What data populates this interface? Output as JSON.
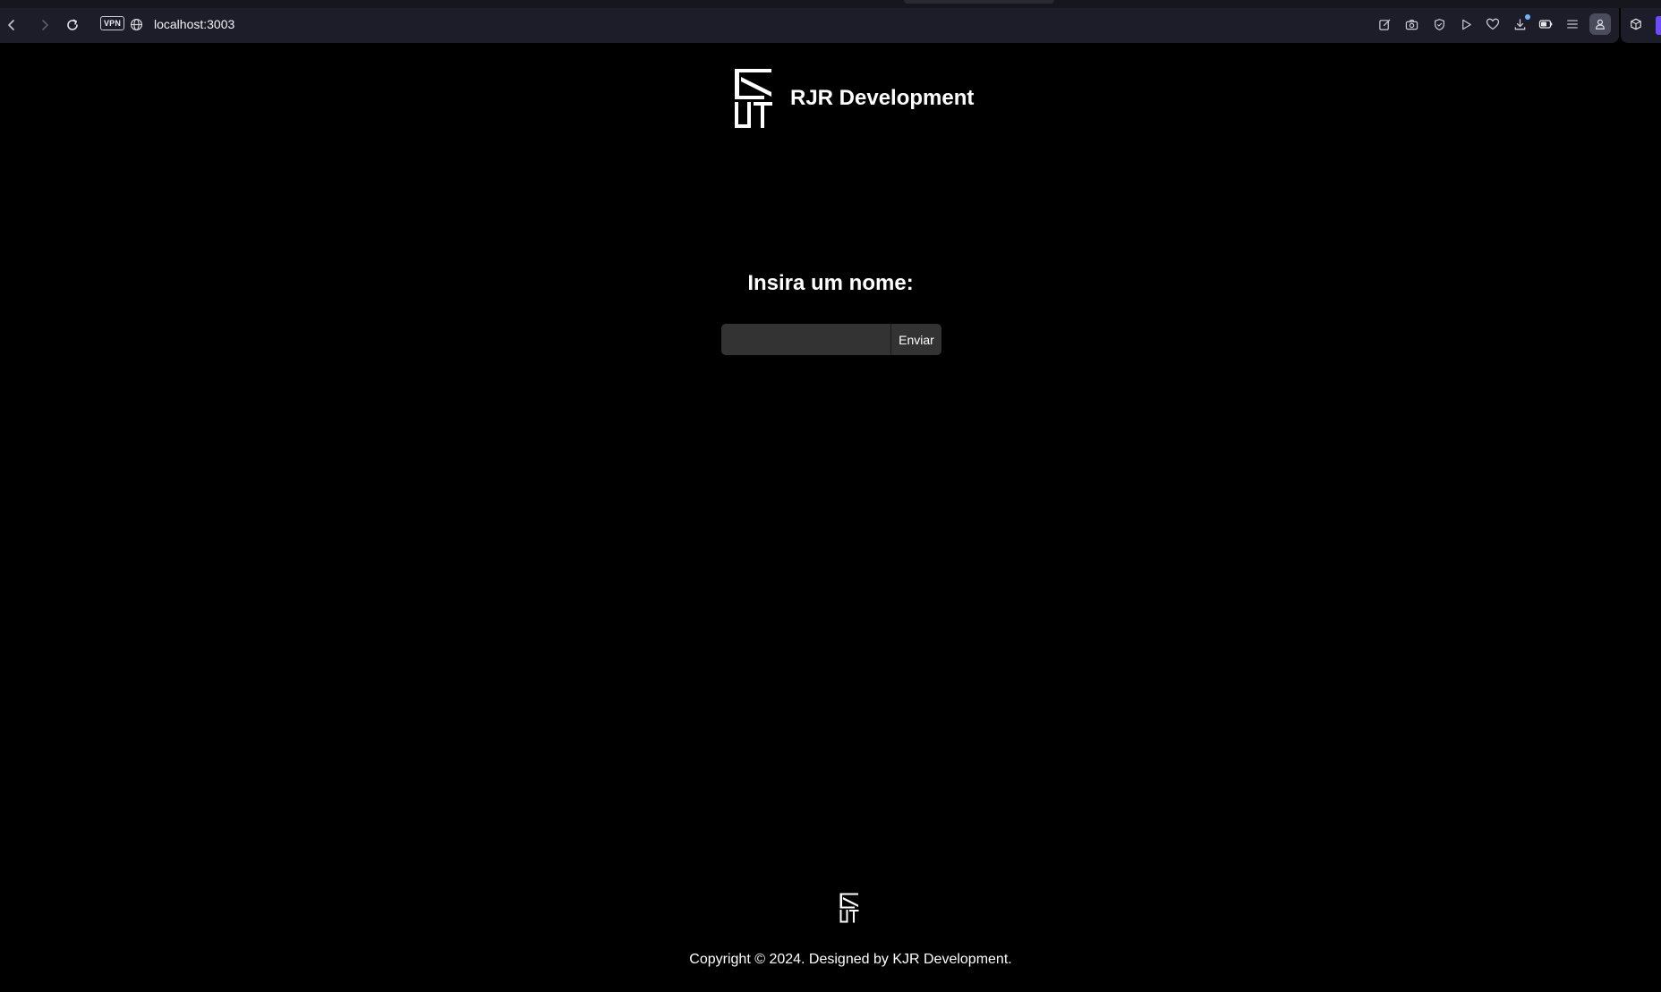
{
  "browser": {
    "url": "localhost:3003",
    "vpn_label": "VPN",
    "accent_color": "#6b4cf6",
    "icons": {
      "back": "back-arrow-icon",
      "forward": "forward-arrow-icon",
      "reload": "reload-icon",
      "site": "globe-icon",
      "toolbar": [
        "edit-icon",
        "camera-icon",
        "shield-icon",
        "play-icon",
        "heart-icon",
        "download-icon",
        "battery-icon",
        "menu-icon",
        "profile-icon",
        "cube-icon"
      ]
    }
  },
  "header": {
    "brand": "RJR Development",
    "logo": "rj-logo-icon"
  },
  "main": {
    "prompt": "Insira um nome:",
    "name_input": {
      "value": "",
      "placeholder": ""
    },
    "submit_label": "Enviar"
  },
  "footer": {
    "logo": "rj-logo-icon",
    "copyright": "Copyright © 2024. Designed by KJR Development."
  },
  "colors": {
    "background": "#000000",
    "browser_bar": "#1d1d29",
    "input_bg": "#333333",
    "text": "#ffffff"
  }
}
